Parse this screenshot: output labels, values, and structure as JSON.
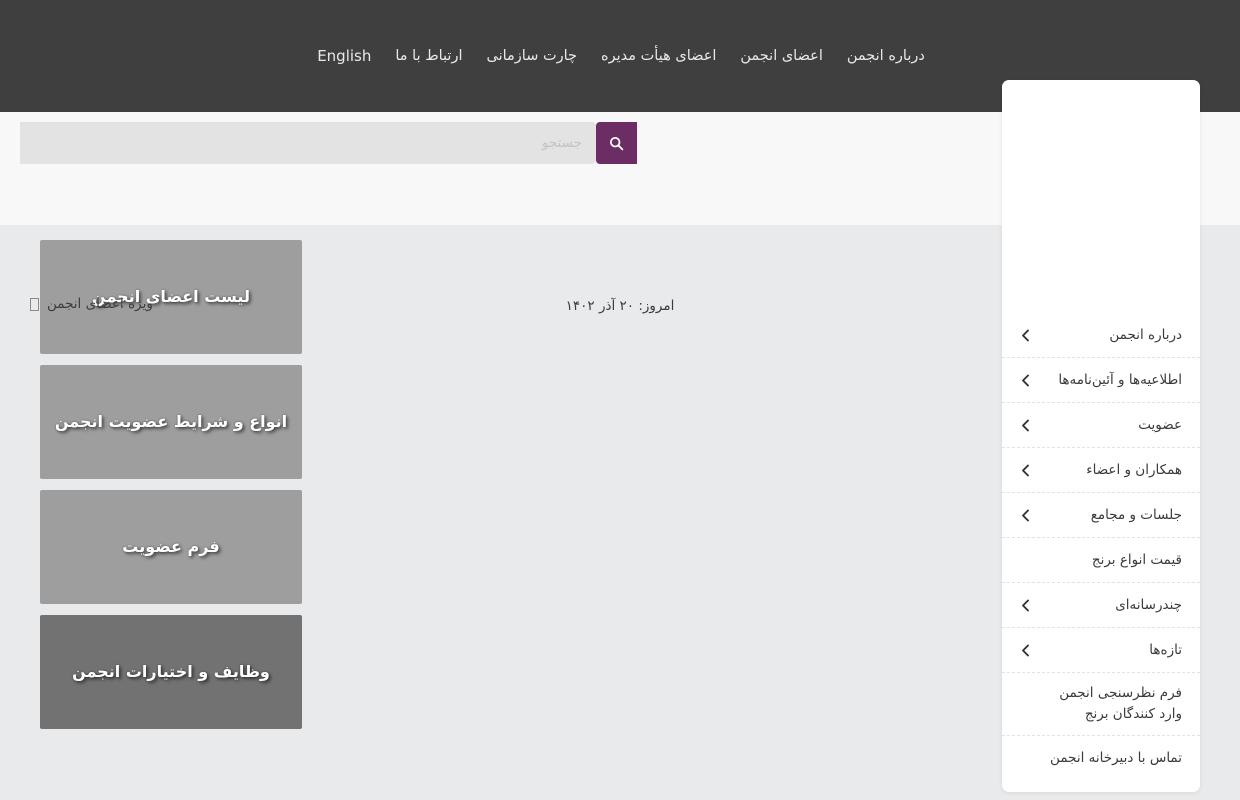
{
  "nav": {
    "items": [
      {
        "label": "درباره انجمن",
        "latin": false
      },
      {
        "label": "اعضای انجمن",
        "latin": false
      },
      {
        "label": "اعضای هیأت مدیره",
        "latin": false
      },
      {
        "label": "چارت سازمانی",
        "latin": false
      },
      {
        "label": "ارتباط با ما",
        "latin": false
      },
      {
        "label": "English",
        "latin": true
      }
    ]
  },
  "search": {
    "placeholder": "جستجو",
    "value": "",
    "button_icon": "search-icon"
  },
  "infobar": {
    "today": "امروز: ۲۰ آذر ۱۴۰۲",
    "members_link": "ویژه اعضای انجمن"
  },
  "cards": [
    {
      "title": "لیست اعضای انجمن",
      "color": "#9e9e9e"
    },
    {
      "title": "انواع و شرایط عضویت انجمن",
      "color": "#9e9e9e"
    },
    {
      "title": "فرم عضویت",
      "color": "#9e9e9e"
    },
    {
      "title": "وظایف و اختیارات انجمن",
      "color": "#727272"
    }
  ],
  "sidebar": {
    "items": [
      {
        "label": "درباره انجمن",
        "chevron": true
      },
      {
        "label": "اطلاعیه‌ها و آئین‌نامه‌ها",
        "chevron": true
      },
      {
        "label": "عضویت",
        "chevron": true
      },
      {
        "label": "همکاران و اعضاء",
        "chevron": true
      },
      {
        "label": "جلسات و مجامع",
        "chevron": true
      },
      {
        "label": "قیمت انواع برنج",
        "chevron": false
      },
      {
        "label": "چندرسانه‌ای",
        "chevron": true
      },
      {
        "label": "تازه‌ها",
        "chevron": true
      },
      {
        "label": "فرم نظرسنجی انجمن وارد کنندگان برنج",
        "chevron": false
      },
      {
        "label": "تماس با دبیرخانه انجمن",
        "chevron": false
      }
    ]
  },
  "colors": {
    "header_bg": "#3f3f3f",
    "accent_purple": "#6b2d63",
    "page_bg": "#e9eaec",
    "strip_bg": "#f8f8f9"
  }
}
